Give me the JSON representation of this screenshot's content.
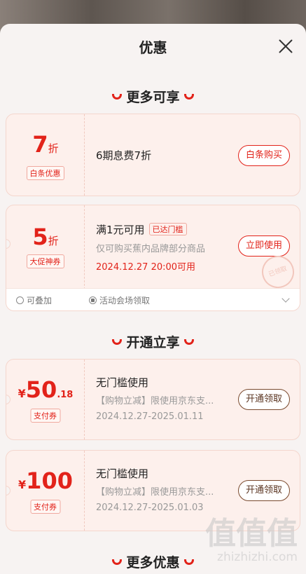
{
  "sheet": {
    "title": "优惠"
  },
  "sections": {
    "more_enjoy": "更多可享",
    "open_enjoy": "开通立享",
    "more_discounts": "更多优惠"
  },
  "coupons": [
    {
      "value": "7",
      "unit": "折",
      "tag": "白条优惠",
      "title": "6期息费7折",
      "button": "白条购买"
    },
    {
      "value": "5",
      "unit": "折",
      "tag": "大促神券",
      "title": "满1元可用",
      "badge": "已达门槛",
      "desc": "仅可购买蕉内品牌部分商品",
      "time": "2024.12.27 20:00可用",
      "button": "立即使用",
      "stamp": "已领取",
      "footer": {
        "stackable": "可叠加",
        "source": "活动会场领取"
      }
    },
    {
      "currency": "¥",
      "value": "50",
      "decimal": ".18",
      "tag": "支付券",
      "title": "无门槛使用",
      "desc": "【购物立减】限使用京东支...",
      "time": "2024.12.27-2025.01.11",
      "button": "开通领取"
    },
    {
      "currency": "¥",
      "value": "100",
      "tag": "支付券",
      "title": "无门槛使用",
      "desc": "【购物立减】限使用京东支...",
      "time": "2024.12.27-2025.01.03",
      "button": "开通领取"
    }
  ],
  "watermark": {
    "logo": "值值值",
    "url": "zhizhizhi.com"
  }
}
